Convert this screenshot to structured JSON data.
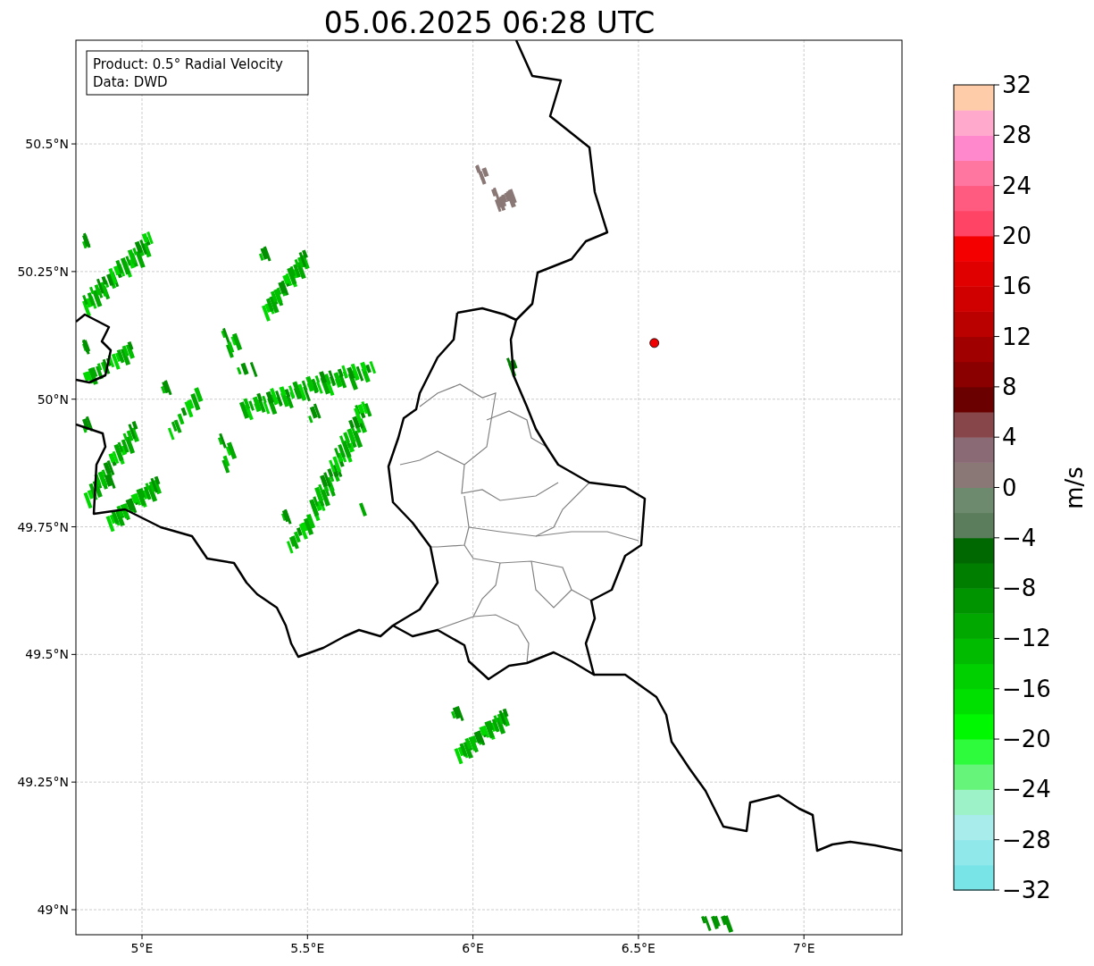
{
  "title": "05.06.2025 06:28 UTC",
  "info_box": [
    "Product: 0.5° Radial Velocity",
    "Data: DWD"
  ],
  "map": {
    "xticks": [
      "5°E",
      "5.5°E",
      "6°E",
      "6.5°E",
      "7°E"
    ],
    "yticks": [
      "50.5°N",
      "50.25°N",
      "50°N",
      "49.75°N",
      "49.5°N",
      "49.25°N",
      "49°N"
    ]
  },
  "colorbar": {
    "label": "m/s",
    "ticks": [
      "32",
      "28",
      "24",
      "20",
      "16",
      "12",
      "8",
      "4",
      "0",
      "−4",
      "−8",
      "−12",
      "−16",
      "−20",
      "−24",
      "−28",
      "−32"
    ]
  }
}
